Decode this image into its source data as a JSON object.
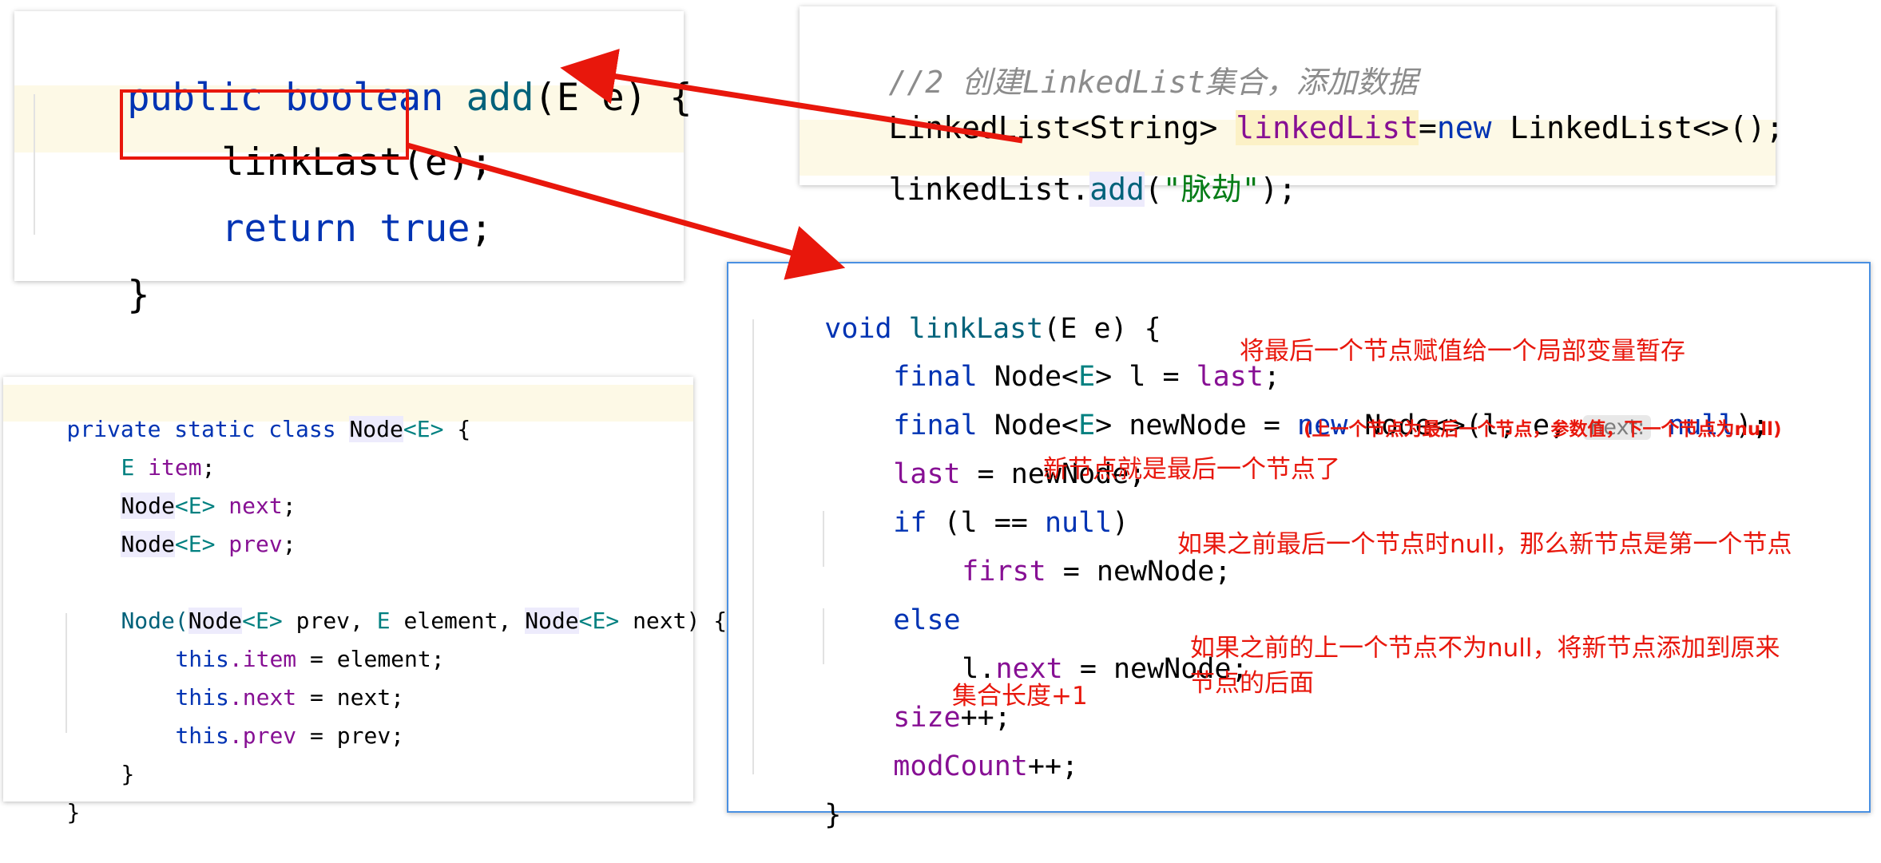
{
  "add_method": {
    "line1": {
      "kw": "public boolean",
      "fn": "add",
      "rest": "(E e) {"
    },
    "line2": "linkLast(e);",
    "line3": {
      "kw": "return true",
      "rest": ";"
    },
    "line4": "}"
  },
  "snippet": {
    "comment": "//2 创建LinkedList集合，添加数据",
    "line2": {
      "type": "LinkedList<String> ",
      "var": "linkedList",
      "eq": "=",
      "kw": "new",
      "rest": " LinkedList<>();"
    },
    "line3": {
      "var": "linkedList.",
      "method": "add",
      "open": "(",
      "str": "\"脉劫\"",
      "close": ");"
    }
  },
  "node_class": {
    "l1": {
      "kw": "private static class ",
      "cls": "Node",
      "gen": "<E>",
      "rest": " {"
    },
    "l2": {
      "gen": "E ",
      "fld": "item",
      "rest": ";"
    },
    "l3": {
      "cls": "Node",
      "gen": "<E>",
      "fld": " next",
      "rest": ";"
    },
    "l4": {
      "cls": "Node",
      "gen": "<E>",
      "fld": " prev",
      "rest": ";"
    },
    "l5": {
      "ctor": "Node(",
      "cls": "Node",
      "gen": "<E>",
      "a": " prev, ",
      "gen2": "E",
      "b": " element, ",
      "cls2": "Node",
      "gen3": "<E>",
      "c": " next) {"
    },
    "l6": {
      "kw": "this",
      "fld": ".item",
      "rest": " = element;"
    },
    "l7": {
      "kw": "this",
      "fld": ".next",
      "rest": " = next;"
    },
    "l8": {
      "kw": "this",
      "fld": ".prev",
      "rest": " = prev;"
    },
    "l9": "}",
    "l10": "}"
  },
  "link_last": {
    "l1": {
      "kw": "void",
      "fn": " linkLast",
      "rest": "(E e) {"
    },
    "l2": {
      "kw": "final",
      "a": " Node<",
      "gen": "E",
      "b": "> l = ",
      "fld": "last",
      "c": ";"
    },
    "l3": {
      "kw": "final",
      "a": " Node<",
      "gen": "E",
      "b": "> newNode = ",
      "kw2": "new",
      "c": " Node<>(l, e, ",
      "hint": "next:",
      "kw3": " null",
      "d": ");"
    },
    "l4": {
      "fld": "last",
      "rest": " = newNode;"
    },
    "l5": {
      "kw": "if",
      "a": " (l == ",
      "kw2": "null",
      "b": ")"
    },
    "l6": {
      "fld": "first",
      "rest": " = newNode;"
    },
    "l7": {
      "kw": "else"
    },
    "l8": {
      "a": "l.",
      "fld": "next",
      "rest": " = newNode;"
    },
    "l9": {
      "fld": "size",
      "rest": "++;"
    },
    "l10": {
      "fld": "modCount",
      "rest": "++;"
    },
    "l11": "}"
  },
  "annotations": {
    "n1": "将最后一个节点赋值给一个局部变量暂存",
    "n2": "(上一个节点为最后一个节点，参数值，下一个节点为null)",
    "n3": "新节点就是最后一个节点了",
    "n4": "如果之前最后一个节点时null，那么新节点是第一个节点",
    "n5a": "如果之前的上一个节点不为null，将新节点添加到原来",
    "n5b": "节点的后面",
    "n6": "集合长度+1"
  },
  "colors": {
    "annotation": "#e8170c",
    "frame": "#4a90e2",
    "arrow": "#e8170c"
  }
}
